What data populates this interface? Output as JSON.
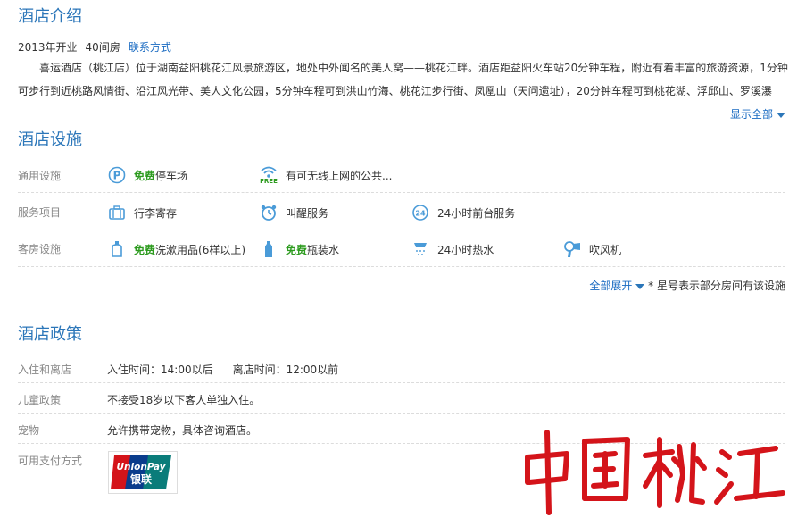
{
  "intro": {
    "title": "酒店介绍",
    "opened": "2013年开业",
    "rooms": "40间房",
    "contact_link": "联系方式",
    "line1": "　　喜运酒店（桃江店）位于湖南益阳桃花江风景旅游区，地处中外闻名的美人窝——桃花江畔。酒店距益阳火车站20分钟车程，附近有着丰富的旅游资源，1分钟",
    "line2": "可步行到近桃路风情街、沿江风光带、美人文化公园，5分钟车程可到洪山竹海、桃花江步行街、凤凰山（天问遗址），20分钟车程可到桃花湖、浮邱山、罗溪瀑",
    "show_all": "显示全部"
  },
  "facilities": {
    "title": "酒店设施",
    "general_label": "通用设施",
    "parking_free": "免费",
    "parking": "停车场",
    "wifi_badge": "FREE",
    "wifi": "有可无线上网的公共...",
    "service_label": "服务项目",
    "luggage": "行李寄存",
    "wakeup": "叫醒服务",
    "frontdesk_badge": "24",
    "frontdesk": "24小时前台服务",
    "room_label": "客房设施",
    "toiletries_free": "免费",
    "toiletries": "洗漱用品(6样以上)",
    "water_free": "免费",
    "water": "瓶装水",
    "hotwater": "24小时热水",
    "hairdryer": "吹风机",
    "expand_all": "全部展开",
    "note": "* 星号表示部分房间有该设施"
  },
  "policy": {
    "title": "酒店政策",
    "checkin_label": "入住和离店",
    "checkin": "入住时间：14:00以后",
    "checkout": "离店时间：12:00以前",
    "children_label": "儿童政策",
    "children": "不接受18岁以下客人单独入住。",
    "pets_label": "宠物",
    "pets": "允许携带宠物，具体咨询酒店。",
    "payment_label": "可用支付方式",
    "unionpay_en": "UnionPay",
    "unionpay_cn": "银联"
  },
  "watermark": {
    "text": "中国桃江",
    "color": "#d4141a"
  },
  "colors": {
    "accent": "#2b76b9",
    "link": "#1a6bc2",
    "free": "#2d9b1f",
    "divider": "#dcdcdc"
  }
}
